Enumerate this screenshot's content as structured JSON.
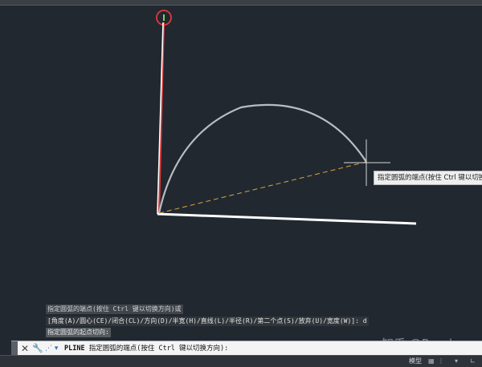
{
  "tooltip": {
    "text": "指定圆弧的端点(按住 Ctrl 键以切换"
  },
  "command_history": [
    "指定圆弧的端点(按住 Ctrl 键以切换方向)或",
    "[角度(A)/圆心(CE)/闭合(CL)/方向(D)/半宽(H)/直线(L)/半径(R)/第二个点(S)/放弃(U)/宽度(W)]: d",
    "指定圆弧的起点切向:"
  ],
  "command_line": {
    "command": "PLINE",
    "prompt": "指定圆弧的端点(按住 Ctrl 键以切换方向):",
    "close_glyph": "✕",
    "tool_glyph": "🔧",
    "recent_glyph": "⋰ ▾"
  },
  "watermark": "知乎 @Randy",
  "status_bar": {
    "model_tab": "模型"
  },
  "colors": {
    "background": "#212830",
    "polyline": "#ffffff",
    "arc": "#b9bcc2",
    "y_axis": "#e03a3a",
    "tangent_dash": "#d9a441"
  }
}
